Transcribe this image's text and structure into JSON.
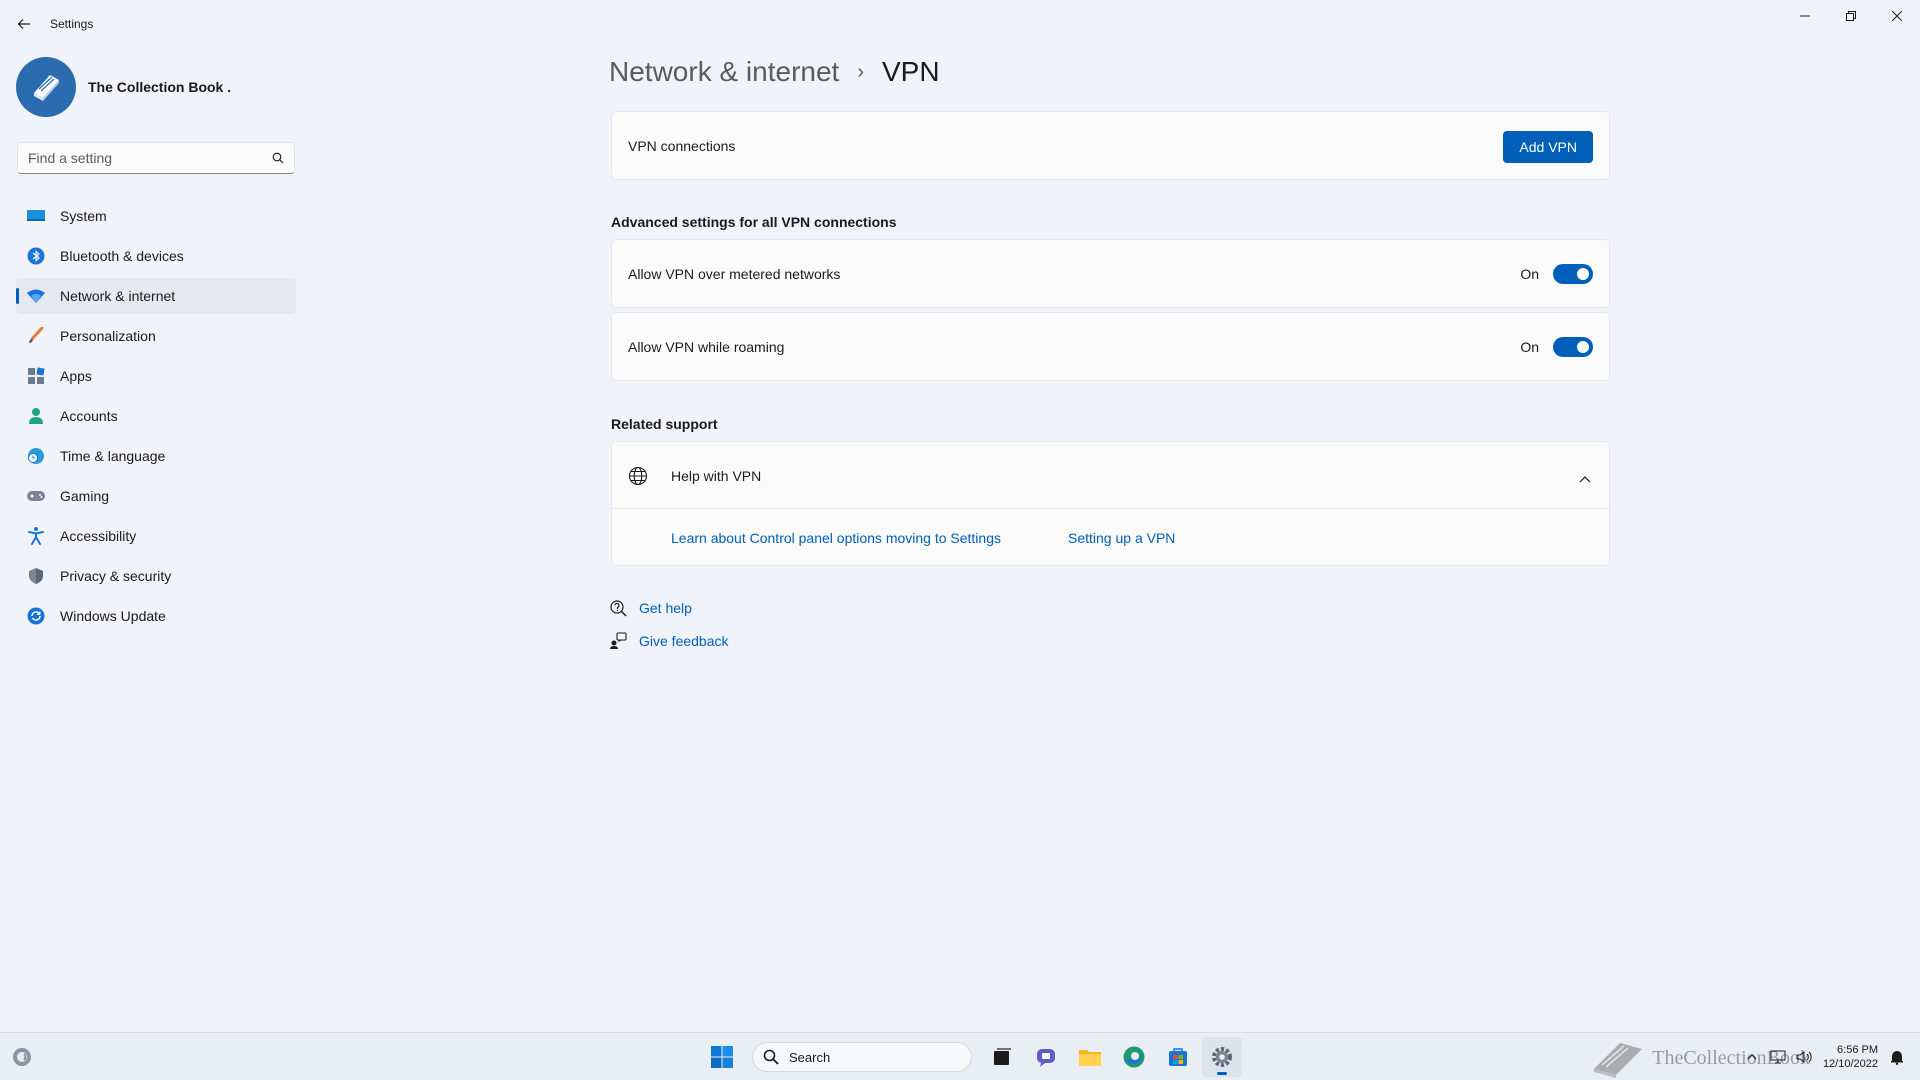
{
  "window": {
    "title": "Settings"
  },
  "profile": {
    "name": "The Collection Book ."
  },
  "search": {
    "placeholder": "Find a setting"
  },
  "sidebar": {
    "items": [
      {
        "label": "System",
        "icon": "monitor-icon"
      },
      {
        "label": "Bluetooth & devices",
        "icon": "bluetooth-icon"
      },
      {
        "label": "Network & internet",
        "icon": "wifi-icon",
        "active": true
      },
      {
        "label": "Personalization",
        "icon": "brush-icon"
      },
      {
        "label": "Apps",
        "icon": "apps-icon"
      },
      {
        "label": "Accounts",
        "icon": "person-icon"
      },
      {
        "label": "Time & language",
        "icon": "globe-clock-icon"
      },
      {
        "label": "Gaming",
        "icon": "gamepad-icon"
      },
      {
        "label": "Accessibility",
        "icon": "accessibility-icon"
      },
      {
        "label": "Privacy & security",
        "icon": "shield-icon"
      },
      {
        "label": "Windows Update",
        "icon": "update-icon"
      }
    ]
  },
  "breadcrumb": {
    "parent": "Network & internet",
    "separator": "›",
    "current": "VPN"
  },
  "vpn": {
    "connections_label": "VPN connections",
    "add_button": "Add VPN"
  },
  "advanced": {
    "title": "Advanced settings for all VPN connections",
    "metered_label": "Allow VPN over metered networks",
    "metered_state": "On",
    "roaming_label": "Allow VPN while roaming",
    "roaming_state": "On"
  },
  "support": {
    "title": "Related support",
    "help_title": "Help with VPN",
    "link_1": "Learn about Control panel options moving to Settings",
    "link_2": "Setting up a VPN"
  },
  "footer": {
    "get_help": "Get help",
    "give_feedback": "Give feedback"
  },
  "taskbar": {
    "search_label": "Search",
    "time": "6:56 PM",
    "date": "12/10/2022",
    "watermark": "TheCollectionBook"
  },
  "colors": {
    "accent": "#005fb8",
    "background": "#f0f3f9",
    "card": "#fbfbfc"
  }
}
